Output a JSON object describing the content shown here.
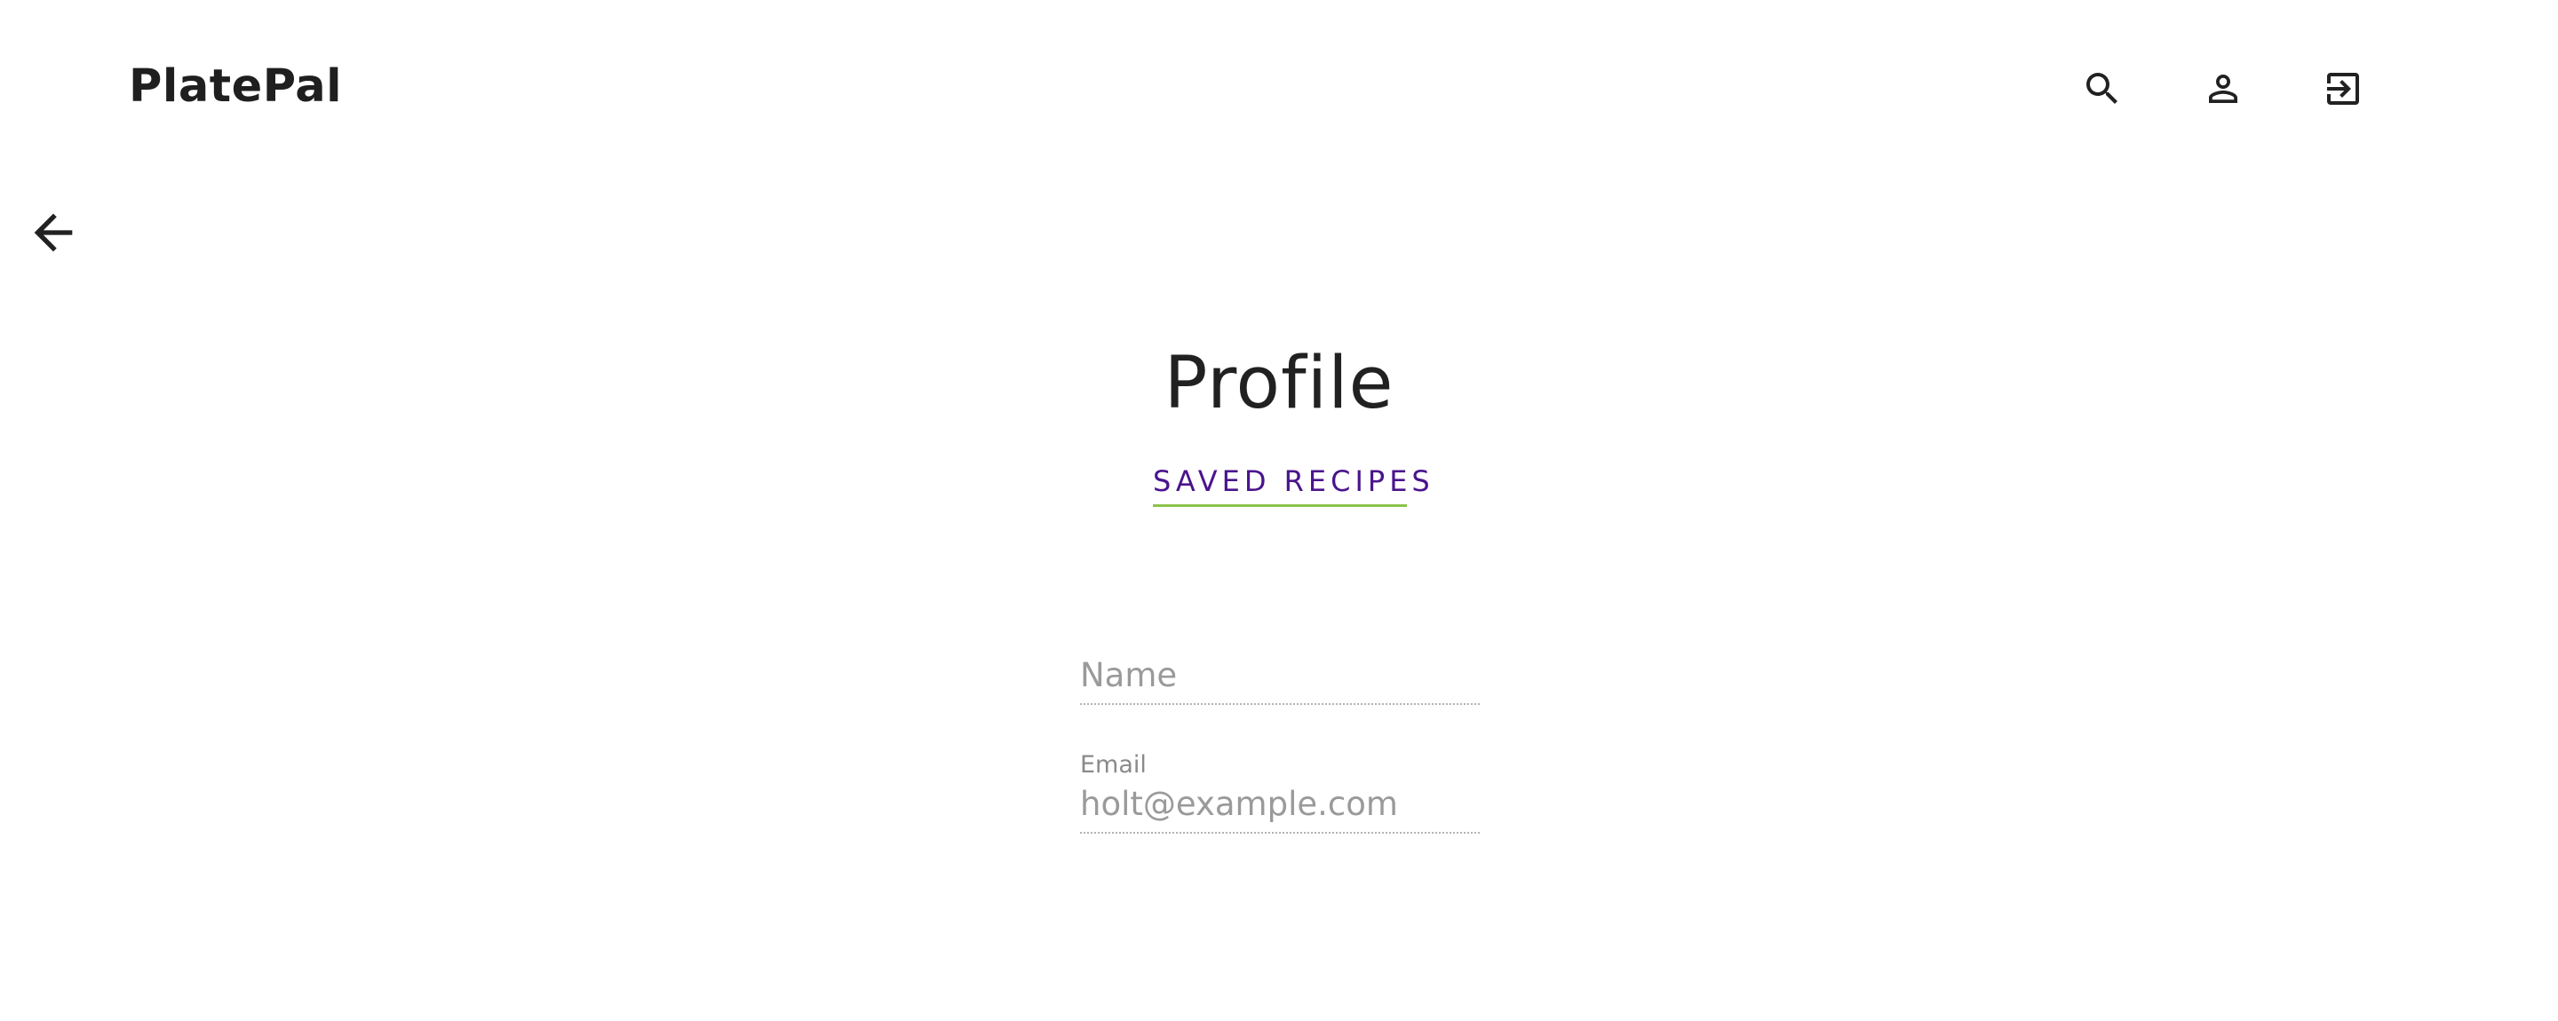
{
  "header": {
    "brand": "PlatePal",
    "icons": [
      "search-icon",
      "person-icon",
      "logout-icon"
    ]
  },
  "nav": {
    "back_icon": "arrow-left-icon"
  },
  "main": {
    "title": "Profile",
    "saved_recipes_link": "SAVED RECIPES",
    "name_field": {
      "label": "",
      "placeholder": "Name",
      "value": ""
    },
    "email_field": {
      "label": "Email",
      "placeholder": "",
      "value": "holt@example.com"
    }
  },
  "colors": {
    "link_text": "#4a148c",
    "link_underline": "#8bc34a",
    "text_primary": "#212121",
    "placeholder": "#9a9a9a"
  }
}
